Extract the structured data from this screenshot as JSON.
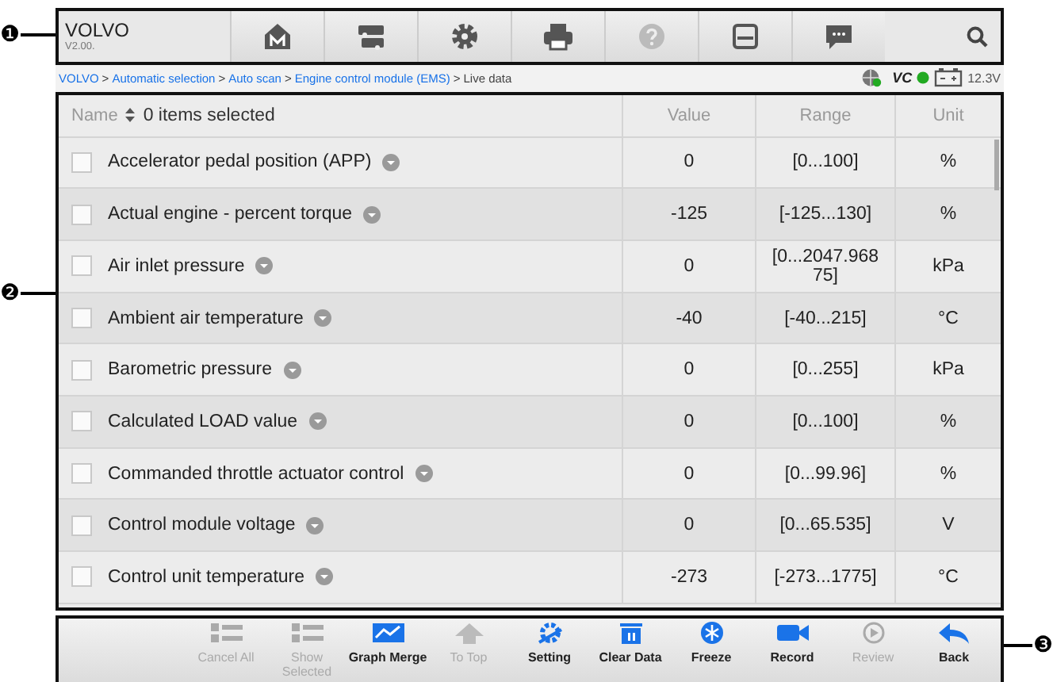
{
  "callouts": [
    {
      "label": "❶",
      "kind": "left"
    },
    {
      "label": "❷",
      "kind": "left"
    },
    {
      "label": "❸",
      "kind": "right"
    }
  ],
  "header": {
    "title": "VOLVO",
    "version": "V2.00.",
    "tools": [
      {
        "kind": "home",
        "disabled": false
      },
      {
        "kind": "vehicle",
        "disabled": false
      },
      {
        "kind": "settings",
        "disabled": false
      },
      {
        "kind": "print",
        "disabled": false
      },
      {
        "kind": "help",
        "disabled": true
      },
      {
        "kind": "save",
        "disabled": false
      },
      {
        "kind": "message",
        "disabled": false
      }
    ]
  },
  "breadcrumb": {
    "links": [
      "VOLVO",
      "Automatic selection",
      "Auto scan",
      "Engine control module (EMS)"
    ],
    "current": "Live data",
    "separator": ">",
    "vci_label": "VC",
    "voltage": "12.3V"
  },
  "table": {
    "columns": [
      "Name",
      "Value",
      "Range",
      "Unit"
    ],
    "selection_count": "0 items selected",
    "rows": [
      {
        "name": "Accelerator pedal position (APP)",
        "value": "0",
        "range": "[0...100]",
        "unit": "%",
        "checked": false
      },
      {
        "name": "Actual engine - percent torque",
        "value": "-125",
        "range": "[-125...130]",
        "unit": "%",
        "checked": false
      },
      {
        "name": "Air inlet pressure",
        "value": "0",
        "range": "[0...2047.96875]",
        "unit": "kPa",
        "checked": false
      },
      {
        "name": "Ambient air temperature",
        "value": "-40",
        "range": "[-40...215]",
        "unit": "°C",
        "checked": false
      },
      {
        "name": "Barometric pressure",
        "value": "0",
        "range": "[0...255]",
        "unit": "kPa",
        "checked": false
      },
      {
        "name": "Calculated LOAD value",
        "value": "0",
        "range": "[0...100]",
        "unit": "%",
        "checked": false
      },
      {
        "name": "Commanded throttle actuator control",
        "value": "0",
        "range": "[0...99.96]",
        "unit": "%",
        "checked": false
      },
      {
        "name": "Control module voltage",
        "value": "0",
        "range": "[0...65.535]",
        "unit": "V",
        "checked": false
      },
      {
        "name": "Control unit temperature",
        "value": "-273",
        "range": "[-273...1775]",
        "unit": "°C",
        "checked": false
      }
    ]
  },
  "toolbar": [
    {
      "label": "Cancel All",
      "kind": "list-x",
      "disabled": true
    },
    {
      "label": "Show Selected",
      "kind": "list-check",
      "disabled": true
    },
    {
      "label": "Graph Merge",
      "kind": "graph",
      "disabled": false
    },
    {
      "label": "To Top",
      "kind": "up",
      "disabled": true
    },
    {
      "label": "Setting",
      "kind": "setting",
      "disabled": false
    },
    {
      "label": "Clear Data",
      "kind": "trash",
      "disabled": false
    },
    {
      "label": "Freeze",
      "kind": "snow",
      "disabled": false
    },
    {
      "label": "Record",
      "kind": "camera",
      "disabled": false
    },
    {
      "label": "Review",
      "kind": "play",
      "disabled": true
    },
    {
      "label": "Back",
      "kind": "back",
      "disabled": false
    }
  ]
}
